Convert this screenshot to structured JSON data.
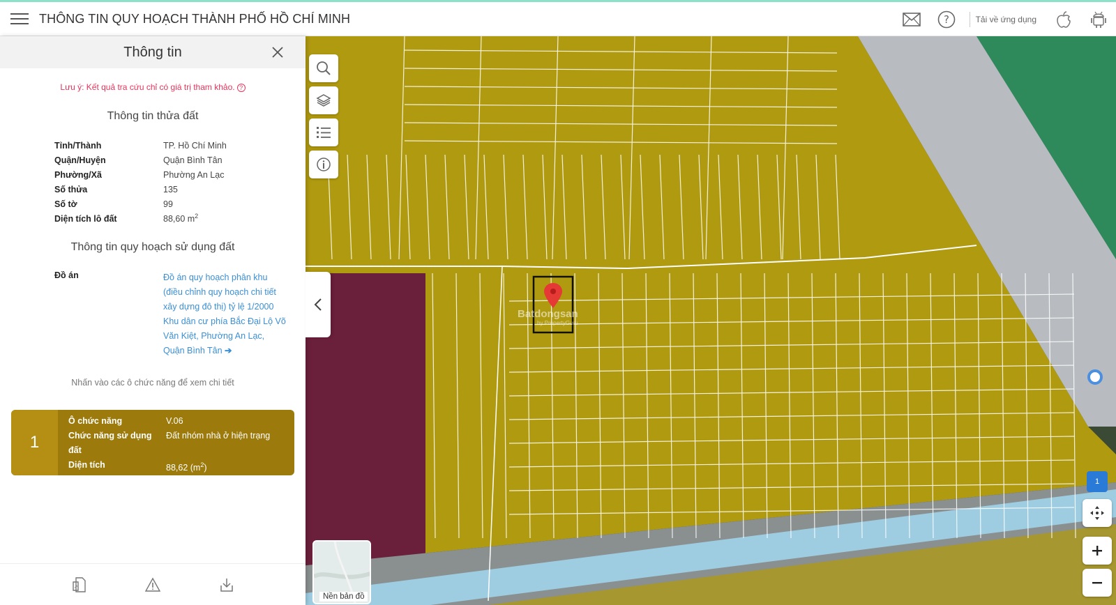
{
  "header": {
    "title": "THÔNG TIN QUY HOẠCH THÀNH PHỐ HỒ CHÍ MINH",
    "download_label": "Tải về ứng dụng"
  },
  "panel": {
    "title": "Thông tin",
    "note": "Lưu ý: Kết quả tra cứu chỉ có giá trị tham khảo.",
    "parcel_section_title": "Thông tin thửa đất",
    "parcel": [
      {
        "key": "Tỉnh/Thành",
        "value": "TP. Hồ Chí Minh"
      },
      {
        "key": "Quận/Huyện",
        "value": "Quận Bình Tân"
      },
      {
        "key": "Phường/Xã",
        "value": "Phường An Lạc"
      },
      {
        "key": "Số thửa",
        "value": "135"
      },
      {
        "key": "Số tờ",
        "value": "99"
      },
      {
        "key": "Diện tích lô đất",
        "value": "88,60 m",
        "sup": "2"
      }
    ],
    "planning_section_title": "Thông tin quy hoạch sử dụng đất",
    "do_an_label": "Đồ án",
    "do_an_link": "Đồ án quy hoạch phân khu (điều chỉnh quy hoạch chi tiết xây dựng đô thị) tỷ lệ 1/2000 Khu dân cư phía Bắc Đại Lộ Võ Văn Kiệt, Phường An Lạc, Quận Bình Tân",
    "hint": "Nhấn vào các ô chức năng để xem chi tiết",
    "function_card": {
      "number": "1",
      "rows": [
        {
          "key": "Ô chức năng",
          "value": "V.06"
        },
        {
          "key": "Chức năng sử dụng đất",
          "value": "Đất nhóm nhà ở hiện trạng"
        },
        {
          "key": "Diện tích",
          "value": "88,62 (m",
          "sup": "2",
          "suffix": ")"
        }
      ]
    }
  },
  "map": {
    "basemap_label": "Nền bản đồ",
    "badge": "1",
    "watermark": "Batdongsan",
    "watermark_sub": "by PropertyGuru",
    "colors": {
      "residential": "#b09a10",
      "mixed": "#6a1f3a",
      "green": "#2e8a5a",
      "canal": "#9fd0e6",
      "marker": "#e53935"
    }
  }
}
